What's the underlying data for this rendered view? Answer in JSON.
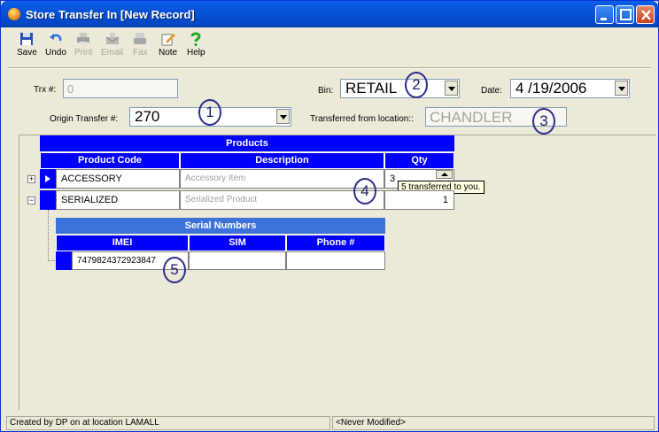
{
  "window": {
    "title": "Store Transfer In [New Record]"
  },
  "toolbar": {
    "save": "Save",
    "undo": "Undo",
    "print": "Print",
    "email": "Email",
    "fax": "Fax",
    "note": "Note",
    "help": "Help"
  },
  "form": {
    "trx_label": "Trx #:",
    "trx_value": "0",
    "bin_label": "Bin:",
    "bin_value": "RETAIL",
    "date_label": "Date:",
    "date_value": "4 /19/2006",
    "origin_label": "Origin Transfer #:",
    "origin_value": "270",
    "from_label": "Transferred from location::",
    "from_value": "CHANDLER"
  },
  "products": {
    "caption": "Products",
    "columns": [
      "Product Code",
      "Description",
      "Qty"
    ],
    "rows": [
      {
        "code": "ACCESSORY",
        "description": "Accessory Item",
        "qty": "3"
      },
      {
        "code": "SERIALIZED",
        "description": "Serialized Product",
        "qty": "1"
      }
    ],
    "tooltip": "5 transferred to you."
  },
  "serials": {
    "caption": "Serial Numbers",
    "columns": [
      "IMEI",
      "SIM",
      "Phone #"
    ],
    "rows": [
      {
        "imei": "7479824372923847",
        "sim": "",
        "phone": ""
      }
    ]
  },
  "annotations": [
    "1",
    "2",
    "3",
    "4",
    "5"
  ],
  "status": {
    "created": "Created by DP on  at location LAMALL",
    "modified": "<Never Modified>"
  },
  "colors": {
    "grid_header": "#0000ff",
    "title_bar": "#0653d6",
    "annotation": "#2b2f8e"
  }
}
